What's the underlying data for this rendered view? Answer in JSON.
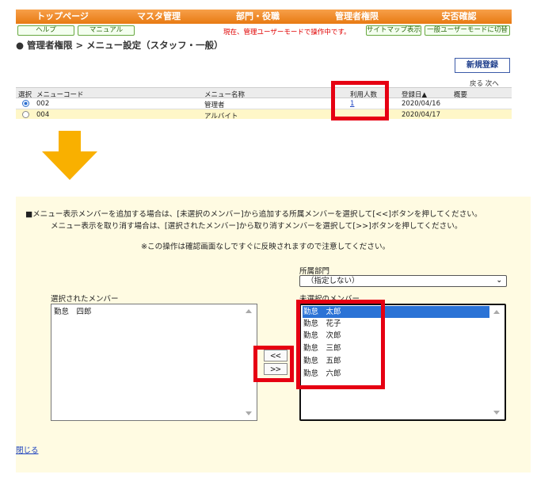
{
  "top": {
    "nav": [
      "トップページ",
      "マスタ管理",
      "部門・役職",
      "管理者権限",
      "安否確認"
    ],
    "help_label": "ヘルプ",
    "manual_label": "マニュアル",
    "mode_text": "現在、管理ユーザーモードで操作中です。",
    "sitemap_label": "サイトマップ表示",
    "switch_mode_label": "一般ユーザーモードに切替",
    "page_title": "● 管理者権限 > メニュー設定（スタッフ・一般）",
    "new_button": "新規登録",
    "pager": "戻る 次へ",
    "columns": {
      "select": "選択",
      "code": "メニューコード",
      "name": "メニュー名称",
      "users": "利用人数",
      "date": "登録日▲",
      "summary": "概要"
    },
    "row1": {
      "code": "002",
      "name": "管理者",
      "users": "1",
      "date": "2020/04/16"
    },
    "row2": {
      "code": "004",
      "name": "アルバイト",
      "users": "",
      "date": "2020/04/17"
    }
  },
  "panel": {
    "notice_line1": "■メニュー表示メンバーを追加する場合は、[未選択のメンバー]から追加する所属メンバーを選択して[<<]ボタンを押してください。",
    "notice_line2": "メニュー表示を取り消す場合は、[選択されたメンバー]から取り消すメンバーを選択して[>>]ボタンを押してください。",
    "notice_line3": "※この操作は確認画面なしですぐに反映されますので注意してください。",
    "dept_label": "所属部門",
    "dept_value": "（指定しない）",
    "selected_label": "選択されたメンバー",
    "unselected_label": "未選択のメンバー",
    "selected_members": [
      "勤怠　四郎"
    ],
    "unselected_members": [
      "勤怠　太郎",
      "勤怠　花子",
      "勤怠　次郎",
      "勤怠　三郎",
      "勤怠　五郎",
      "勤怠　六郎"
    ],
    "add_button": "<<",
    "remove_button": ">>",
    "close_link": "閉じる"
  },
  "colors": {
    "nav_orange": "#e87a12",
    "highlight_red": "#e60012",
    "arrow_orange": "#f9b000",
    "panel_bg": "#fffbe2",
    "selected_option": "#2b73d6"
  }
}
